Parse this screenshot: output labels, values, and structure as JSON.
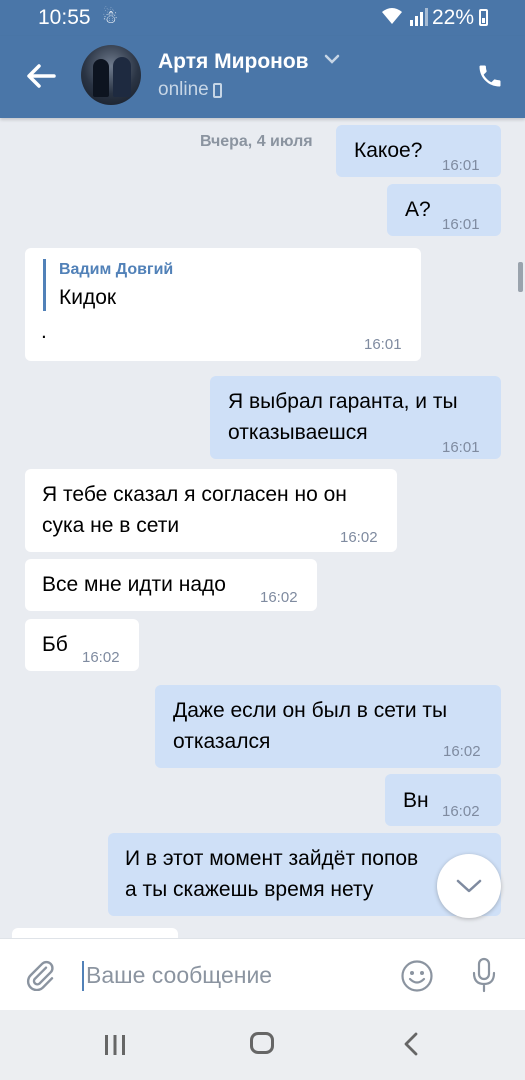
{
  "statusbar": {
    "time": "10:55",
    "battery": "22%"
  },
  "header": {
    "contact_name": "Артя Миронов",
    "status": "online"
  },
  "chat": {
    "date_separator": "Вчера, 4 июля",
    "messages": [
      {
        "direction": "out",
        "text": "Какое?",
        "time": "16:01"
      },
      {
        "direction": "out",
        "text": "А?",
        "time": "16:01"
      },
      {
        "direction": "in",
        "reply_author": "Вадим Довгий",
        "reply_text": "Кидок",
        "text": ".",
        "time": "16:01"
      },
      {
        "direction": "out",
        "text_line1": "Я выбрал гаранта, и ты",
        "text_line2": "отказываешся",
        "time": "16:01"
      },
      {
        "direction": "in",
        "text_line1": "Я тебе сказал я согласен но он",
        "text_line2": "сука не в сети",
        "time": "16:02"
      },
      {
        "direction": "in",
        "text": "Все мне идти надо",
        "time": "16:02"
      },
      {
        "direction": "in",
        "text": "Бб",
        "time": "16:02"
      },
      {
        "direction": "out",
        "text_line1": "Даже если он был в сети ты",
        "text_line2": "отказался",
        "time": "16:02"
      },
      {
        "direction": "out",
        "text": "Вн",
        "time": "16:02"
      },
      {
        "direction": "out",
        "text_line1": "И в этот момент зайдёт попов",
        "text_line2": "а ты скажешь время нету",
        "time": ""
      }
    ]
  },
  "composer": {
    "placeholder": "Ваше сообщение"
  },
  "icons": {
    "back": "arrow-left-icon",
    "call": "phone-icon",
    "attach": "paperclip-icon",
    "emoji": "smiley-icon",
    "mic": "microphone-icon",
    "scroll_down": "chevron-down-icon"
  },
  "colors": {
    "header": "#4a76a8",
    "outgoing_bubble": "#cfe0f7",
    "incoming_bubble": "#ffffff",
    "chat_bg": "#e9ecf1",
    "accent": "#5181b8"
  }
}
